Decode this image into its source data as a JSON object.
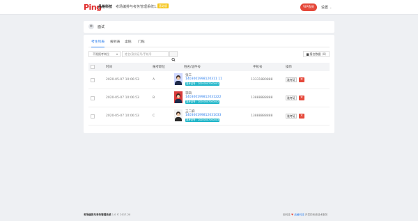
{
  "header": {
    "logo_text": "Ping",
    "brand_cn": "品格科技",
    "system_title": "考场编排与考务管理系统1.0",
    "version_badge": "基础版",
    "vip_button": "VIP会员",
    "settings_label": "设置"
  },
  "breadcrumb": {
    "title": "面试"
  },
  "tabs": [
    {
      "label": "考生列表",
      "active": true
    },
    {
      "label": "报到表",
      "active": false
    },
    {
      "label": "桌贴",
      "active": false
    },
    {
      "label": "门贴",
      "active": false
    }
  ],
  "filters": {
    "status_select": "不限报考岗位",
    "search_placeholder": "姓名/身份证号/手机号",
    "export_label": "报名数据",
    "export_count": "(8)"
  },
  "table": {
    "headers": [
      "时间",
      "报考职位",
      "姓名/证件号",
      "手机号",
      "操作"
    ],
    "rows": [
      {
        "time": "2020-05-07 10:06:53",
        "position": "A",
        "name": "张三",
        "id_number": "1403001998120311 11",
        "badge": "准考证号：20200507000001",
        "phone": "13331880888",
        "edit": "准考证"
      },
      {
        "time": "2020-05-07 10:06:53",
        "position": "B",
        "name": "李四",
        "id_number": "140300199812031222",
        "badge": "准考证号：20200507000002",
        "phone": "13888888888",
        "edit": "准考证"
      },
      {
        "time": "2020-05-07 10:06:53",
        "position": "C",
        "name": "王二麻",
        "id_number": "140300199812031033",
        "badge": "准考证号：20200507000003",
        "phone": "13888888888",
        "edit": "准考证"
      }
    ]
  },
  "footer": {
    "left_bold": "考场编排与考务管理系统",
    "left_rest": "1.0 © 2017-20",
    "right_prefix": "用科技",
    "right_brand": "品格科技",
    "right_suffix": "开发的系统技术服务"
  },
  "colors": {
    "accent": "#2f80ed",
    "danger": "#e5483a",
    "badge": "#1fb6c9",
    "version": "#f5c518"
  }
}
